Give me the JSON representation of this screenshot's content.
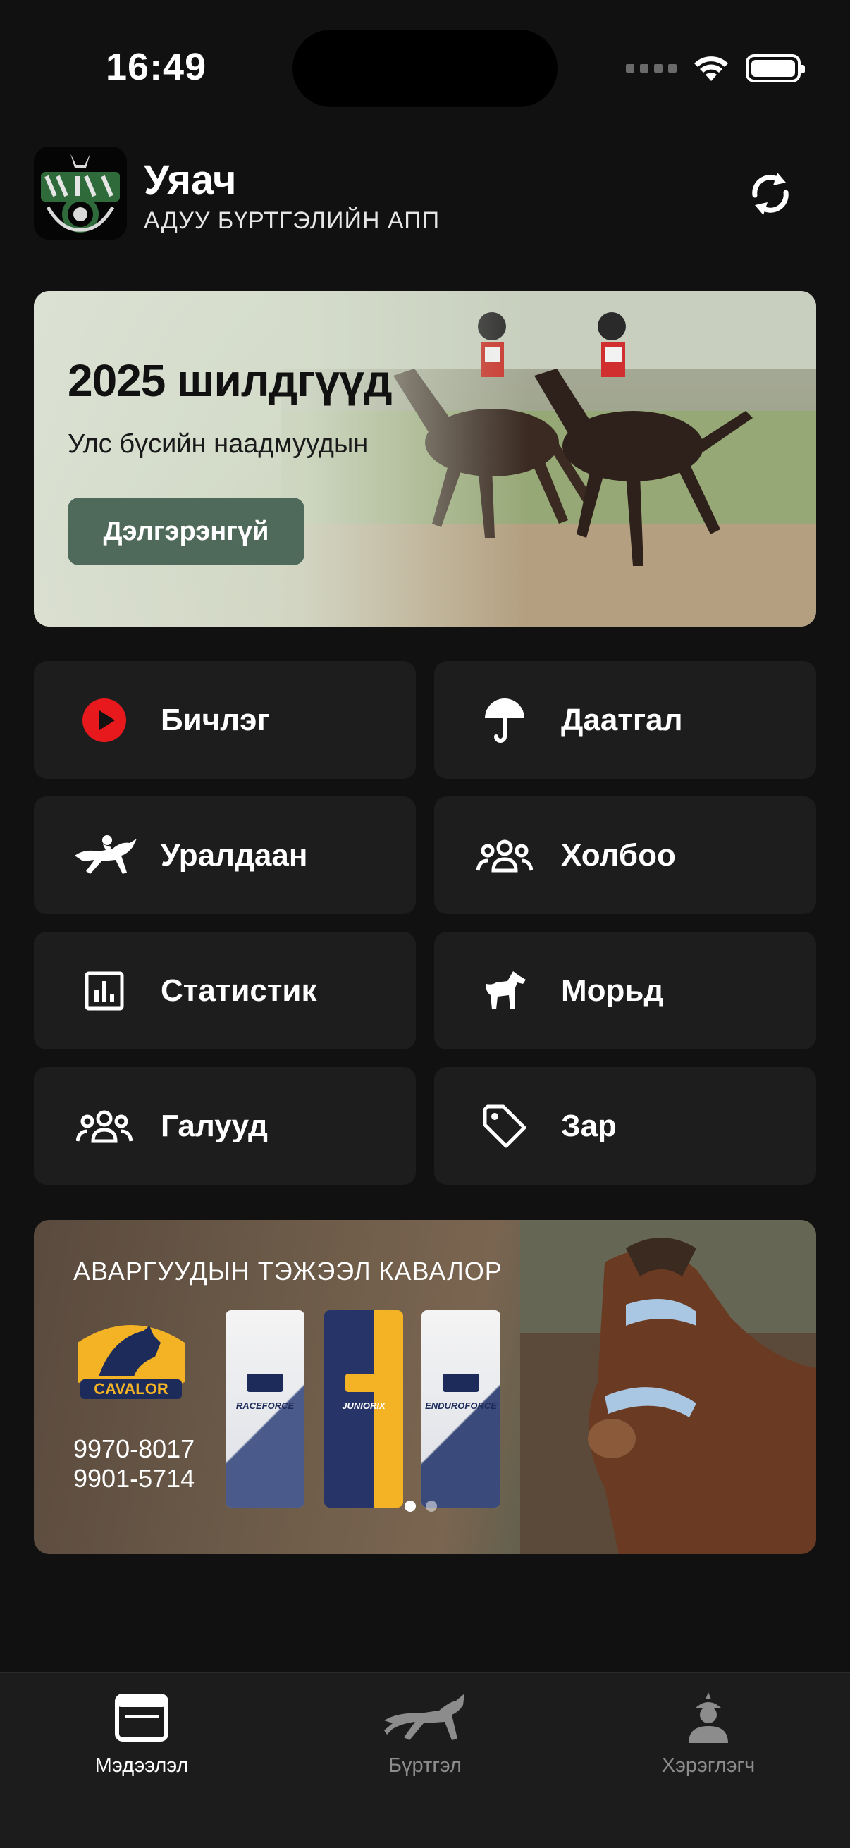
{
  "status_bar": {
    "time": "16:49"
  },
  "header": {
    "title": "Уяач",
    "subtitle": "АДУУ БҮРТГЭЛИЙН АПП"
  },
  "hero": {
    "title": "2025 шилдгүүд",
    "subtitle": "Улс бүсийн наадмуудын",
    "button_label": "Дэлгэрэнгүй"
  },
  "tiles": [
    {
      "label": "Бичлэг",
      "icon": "play-icon"
    },
    {
      "label": "Даатгал",
      "icon": "umbrella-icon"
    },
    {
      "label": "Уралдаан",
      "icon": "horse-racing-icon"
    },
    {
      "label": "Холбоо",
      "icon": "group-icon"
    },
    {
      "label": "Статистик",
      "icon": "chart-icon"
    },
    {
      "label": "Морьд",
      "icon": "horse-icon"
    },
    {
      "label": "Галууд",
      "icon": "group-icon"
    },
    {
      "label": "Зар",
      "icon": "tag-icon"
    }
  ],
  "ad": {
    "title": "АВАРГУУДЫН ТЭЖЭЭЛ КАВАЛОР",
    "brand": "CAVALOR",
    "phone_1": "9970-8017",
    "phone_2": "9901-5714",
    "products": [
      "RACEFORCE",
      "JUNIORIX",
      "ENDUROFORCE"
    ],
    "slide_count": 2,
    "active_slide": 1
  },
  "tabbar": {
    "tabs": [
      {
        "label": "Мэдээлэл",
        "icon": "news-icon",
        "active": true
      },
      {
        "label": "Бүртгэл",
        "icon": "horse-icon",
        "active": false
      },
      {
        "label": "Хэрэглэгч",
        "icon": "user-icon",
        "active": false
      }
    ]
  },
  "colors": {
    "background": "#111111",
    "tile": "#1d1d1e",
    "hero_button": "#4f6a5a",
    "play_red": "#e8191c"
  }
}
